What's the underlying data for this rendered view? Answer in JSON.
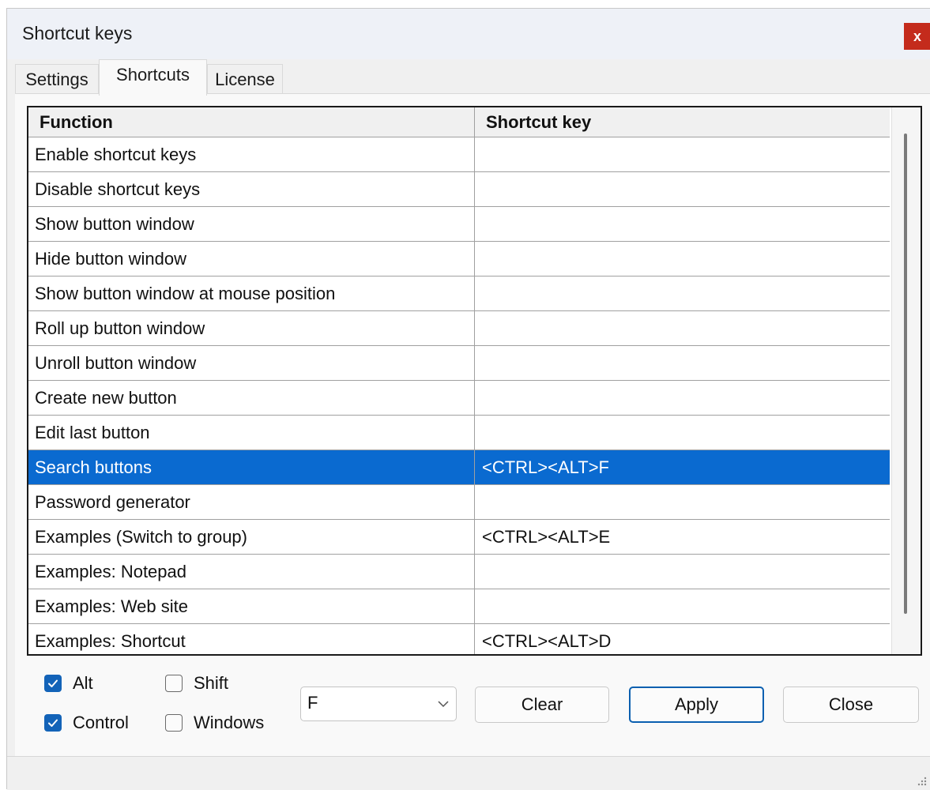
{
  "window": {
    "title": "Shortcut keys",
    "close_label": "x"
  },
  "tabs": [
    {
      "label": "Settings",
      "active": false
    },
    {
      "label": "Shortcuts",
      "active": true
    },
    {
      "label": "License",
      "active": false
    }
  ],
  "grid": {
    "columns": [
      "Function",
      "Shortcut key"
    ],
    "selected_row": 9,
    "rows": [
      {
        "function": "Enable shortcut keys",
        "key": ""
      },
      {
        "function": "Disable shortcut keys",
        "key": ""
      },
      {
        "function": "Show button window",
        "key": ""
      },
      {
        "function": "Hide button window",
        "key": ""
      },
      {
        "function": "Show button window at mouse position",
        "key": ""
      },
      {
        "function": "Roll up button window",
        "key": ""
      },
      {
        "function": "Unroll button window",
        "key": ""
      },
      {
        "function": "Create new button",
        "key": ""
      },
      {
        "function": "Edit last button",
        "key": ""
      },
      {
        "function": "Search buttons",
        "key": "<CTRL><ALT>F"
      },
      {
        "function": "Password generator",
        "key": ""
      },
      {
        "function": "Examples (Switch to group)",
        "key": "<CTRL><ALT>E"
      },
      {
        "function": "Examples: Notepad",
        "key": ""
      },
      {
        "function": "Examples: Web site",
        "key": ""
      },
      {
        "function": "Examples: Shortcut",
        "key": "<CTRL><ALT>D"
      }
    ]
  },
  "modifiers": {
    "alt": {
      "label": "Alt",
      "checked": true
    },
    "control": {
      "label": "Control",
      "checked": true
    },
    "shift": {
      "label": "Shift",
      "checked": false
    },
    "windows": {
      "label": "Windows",
      "checked": false
    }
  },
  "key_select": {
    "value": "F"
  },
  "buttons": {
    "clear": "Clear",
    "apply": "Apply",
    "close": "Close"
  },
  "colors": {
    "selection": "#0a6ad0",
    "checkbox_checked": "#1363b8",
    "close_button": "#c42b1c",
    "default_button_border": "#0a5fb0"
  },
  "icons": {
    "dropdown": "chevron-down-icon",
    "check": "checkmark-icon",
    "grip": "resize-grip-icon"
  }
}
